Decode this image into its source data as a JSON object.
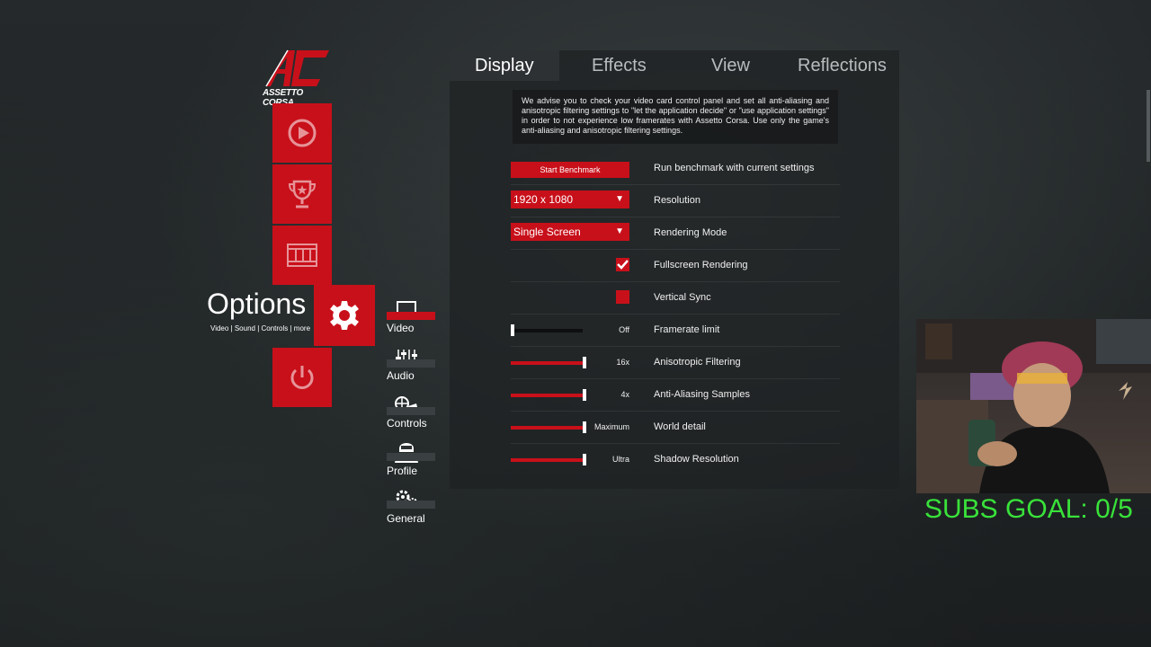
{
  "brand": {
    "name": "ASSETTO CORSA",
    "logo": "ac-logo"
  },
  "left_menu": {
    "tiles": [
      {
        "icon": "drive-icon"
      },
      {
        "icon": "trophy-icon"
      },
      {
        "icon": "replay-film-icon"
      },
      {
        "icon": "gear-icon"
      },
      {
        "icon": "power-icon"
      }
    ],
    "options_title": "Options",
    "options_subtitle": "Video | Sound | Controls | more"
  },
  "sub_menu": {
    "items": [
      {
        "label": "Video",
        "icon": "monitor-icon",
        "active": true
      },
      {
        "label": "Audio",
        "icon": "mixer-icon",
        "active": false
      },
      {
        "label": "Controls",
        "icon": "controls-icon",
        "active": false
      },
      {
        "label": "Profile",
        "icon": "driver-helmet-icon",
        "active": false
      },
      {
        "label": "General",
        "icon": "gears-icon",
        "active": false
      }
    ]
  },
  "tabs": [
    {
      "label": "Display",
      "active": true
    },
    {
      "label": "Effects",
      "active": false
    },
    {
      "label": "View",
      "active": false
    },
    {
      "label": "Reflections",
      "active": false
    }
  ],
  "notice": "We advise you to check your video card control panel and set all anti-aliasing and anisotropic filtering settings to \"let the application decide\" or \"use application settings\" in order to not experience low framerates with Assetto Corsa. Use only the game's anti-aliasing and anisotropic filtering settings.",
  "settings": {
    "benchmark": {
      "button": "Start Benchmark",
      "label": "Run benchmark with current settings"
    },
    "resolution": {
      "value": "1920 x 1080",
      "label": "Resolution"
    },
    "rendering_mode": {
      "value": "Single Screen",
      "label": "Rendering Mode"
    },
    "fullscreen": {
      "checked": true,
      "label": "Fullscreen Rendering"
    },
    "vsync": {
      "checked": false,
      "label": "Vertical Sync"
    },
    "framerate_limit": {
      "value_text": "Off",
      "level": 0.0,
      "label": "Framerate limit"
    },
    "anisotropic": {
      "value_text": "16x",
      "level": 1.0,
      "label": "Anisotropic Filtering"
    },
    "aa_samples": {
      "value_text": "4x",
      "level": 1.0,
      "label": "Anti-Aliasing Samples"
    },
    "world_detail": {
      "value_text": "Maximum",
      "level": 1.0,
      "label": "World detail"
    },
    "shadow_resolution": {
      "value_text": "Ultra",
      "level": 1.0,
      "label": "Shadow Resolution"
    }
  },
  "overlay": {
    "subs_goal": "SUBS GOAL: 0/5"
  },
  "colors": {
    "accent": "#c8101a",
    "panel": "#1e2123",
    "subs_goal": "#39e23a"
  }
}
